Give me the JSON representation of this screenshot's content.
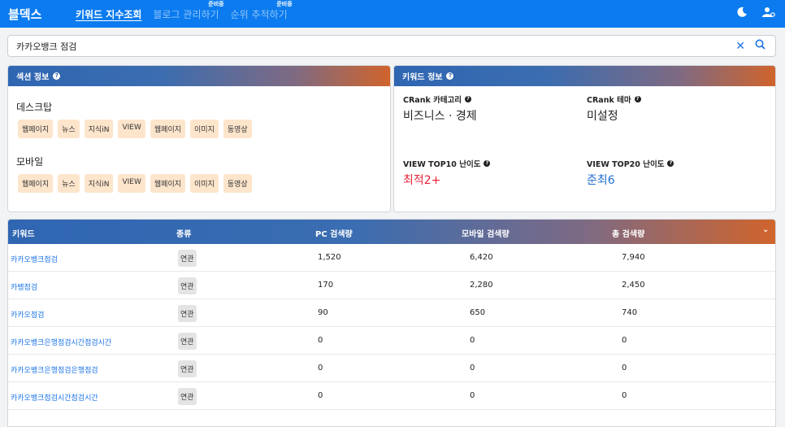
{
  "header": {
    "brand": "블덱스",
    "nav": [
      {
        "label": "키워드 지수조회",
        "active": true,
        "sup": ""
      },
      {
        "label": "블로그 관리하기",
        "active": false,
        "sup": "준비중"
      },
      {
        "label": "순위 추적하기",
        "active": false,
        "sup": "준비중"
      }
    ],
    "icons": [
      "moon-icon",
      "user-settings-icon"
    ]
  },
  "search": {
    "value": "카카오뱅크 점검",
    "clear_icon": "close-icon",
    "search_icon": "search-icon"
  },
  "section_info": {
    "title": "섹션 정보",
    "desktop": {
      "label": "데스크탑",
      "chips": [
        "웹페이지",
        "뉴스",
        "지식iN",
        "VIEW",
        "웹페이지",
        "이미지",
        "동영상"
      ]
    },
    "mobile": {
      "label": "모바일",
      "chips": [
        "웹페이지",
        "뉴스",
        "지식iN",
        "VIEW",
        "웹페이지",
        "이미지",
        "동영상"
      ]
    }
  },
  "keyword_info": {
    "title": "키워드 정보",
    "crank_category_label": "CRank 카테고리",
    "crank_category_value": "비즈니스 · 경제",
    "crank_theme_label": "CRank 테마",
    "crank_theme_value": "미설정",
    "view_top10_label": "VIEW TOP10 난이도",
    "view_top10_value": "최적2+",
    "view_top20_label": "VIEW TOP20 난이도",
    "view_top20_value": "준최6"
  },
  "table": {
    "headers": {
      "keyword": "키워드",
      "type": "종류",
      "pc": "PC 검색량",
      "mobile": "모바일 검색량",
      "total": "총 검색량"
    },
    "rows": [
      {
        "keyword": "카카오뱅크점검",
        "type": "연관",
        "pc": "1,520",
        "mobile": "6,420",
        "total": "7,940"
      },
      {
        "keyword": "카뱅점검",
        "type": "연관",
        "pc": "170",
        "mobile": "2,280",
        "total": "2,450"
      },
      {
        "keyword": "카카오점검",
        "type": "연관",
        "pc": "90",
        "mobile": "650",
        "total": "740"
      },
      {
        "keyword": "카카오뱅크은행점검시간점검시간",
        "type": "연관",
        "pc": "0",
        "mobile": "0",
        "total": "0"
      },
      {
        "keyword": "카카오뱅크은행점검은행점검",
        "type": "연관",
        "pc": "0",
        "mobile": "0",
        "total": "0"
      },
      {
        "keyword": "카카오뱅크점검시간점검시간",
        "type": "연관",
        "pc": "0",
        "mobile": "0",
        "total": "0"
      }
    ]
  }
}
